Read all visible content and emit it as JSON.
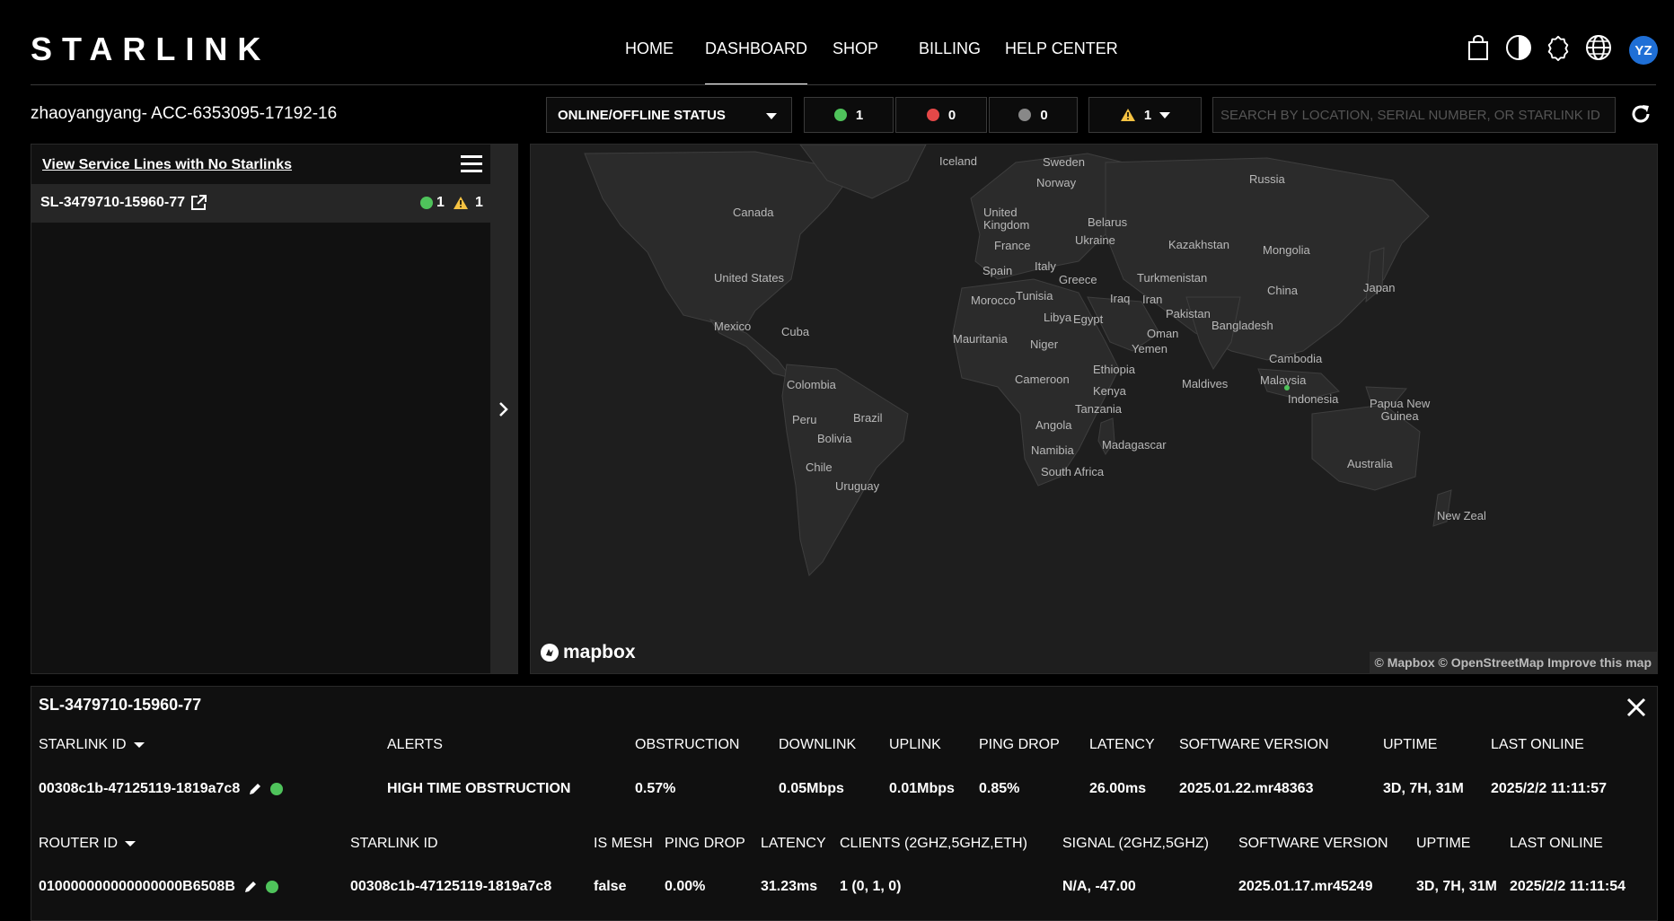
{
  "brand": {
    "logo": "STARLINK"
  },
  "nav": {
    "home": "HOME",
    "dashboard": "DASHBOARD",
    "shop": "SHOP",
    "billing": "BILLING",
    "help": "HELP CENTER"
  },
  "user": {
    "initials": "YZ"
  },
  "icons": [
    "cart-icon",
    "contrast-icon",
    "gear-icon",
    "globe-icon",
    "refresh-icon",
    "external-link-icon",
    "warning-icon",
    "edit-icon",
    "close-icon",
    "chevron-right-icon",
    "menu-icon",
    "mapbox-icon"
  ],
  "filters": {
    "account": "zhaoyangyang- ACC-6353095-17192-16",
    "status_dropdown": "ONLINE/OFFLINE STATUS",
    "online_count": "1",
    "offline_count": "0",
    "unknown_count": "0",
    "alert_count": "1",
    "search_placeholder": "SEARCH BY LOCATION, SERIAL NUMBER, OR STARLINK ID",
    "colors": {
      "online": "#4fc35b",
      "offline": "#e54848",
      "unknown": "#888888",
      "alert": "#f5c242"
    }
  },
  "left_panel": {
    "link": "View Service Lines with No Starlinks",
    "service_lines": [
      {
        "id": "SL-3479710-15960-77",
        "online": "1",
        "alerts": "1"
      }
    ]
  },
  "map": {
    "labels": {
      "iceland": "Iceland",
      "sweden": "Sweden",
      "norway": "Norway",
      "russia": "Russia",
      "canada": "Canada",
      "uk": "United\nKingdom",
      "belarus": "Belarus",
      "ukraine": "Ukraine",
      "france": "France",
      "kazakhstan": "Kazakhstan",
      "mongolia": "Mongolia",
      "spain": "Spain",
      "italy": "Italy",
      "greece": "Greece",
      "turkmenistan": "Turkmenistan",
      "us": "United States",
      "china": "China",
      "japan": "Japan",
      "morocco": "Morocco",
      "tunisia": "Tunisia",
      "iraq": "Iraq",
      "iran": "Iran",
      "pakistan": "Pakistan",
      "libya": "Libya",
      "egypt": "Egypt",
      "bangladesh": "Bangladesh",
      "mexico": "Mexico",
      "cuba": "Cuba",
      "oman": "Oman",
      "mauritania": "Mauritania",
      "niger": "Niger",
      "yemen": "Yemen",
      "cambodia": "Cambodia",
      "ethiopia": "Ethiopia",
      "cameroon": "Cameroon",
      "maldives": "Maldives",
      "malaysia": "Malaysia",
      "colombia": "Colombia",
      "kenya": "Kenya",
      "indonesia": "Indonesia",
      "png": "Papua New\nGuinea",
      "peru": "Peru",
      "brazil": "Brazil",
      "tanzania": "Tanzania",
      "bolivia": "Bolivia",
      "angola": "Angola",
      "madagascar": "Madagascar",
      "namibia": "Namibia",
      "australia": "Australia",
      "chile": "Chile",
      "south_africa": "South Africa",
      "uruguay": "Uruguay",
      "nz": "New Zeal"
    },
    "brand": "mapbox",
    "attribution": {
      "mapbox": "© Mapbox",
      "osm": "© OpenStreetMap",
      "improve": "Improve this map"
    }
  },
  "details": {
    "title": "SL-3479710-15960-77",
    "starlink_headers": {
      "starlink_id": "STARLINK ID",
      "alerts": "ALERTS",
      "obstruction": "OBSTRUCTION",
      "downlink": "DOWNLINK",
      "uplink": "UPLINK",
      "ping_drop": "PING DROP",
      "latency": "LATENCY",
      "software": "SOFTWARE VERSION",
      "uptime": "UPTIME",
      "last_online": "LAST ONLINE"
    },
    "starlink_row": {
      "starlink_id": "00308c1b-47125119-1819a7c8",
      "alerts": "HIGH TIME OBSTRUCTION",
      "obstruction": "0.57%",
      "downlink": "0.05Mbps",
      "uplink": "0.01Mbps",
      "ping_drop": "0.85%",
      "latency": "26.00ms",
      "software": "2025.01.22.mr48363",
      "uptime": "3D, 7H, 31M",
      "last_online": "2025/2/2 11:11:57"
    },
    "router_headers": {
      "router_id": "ROUTER ID",
      "starlink_id": "STARLINK ID",
      "is_mesh": "IS MESH",
      "ping_drop": "PING DROP",
      "latency": "LATENCY",
      "clients": "CLIENTS (2GHZ,5GHZ,ETH)",
      "signal": "SIGNAL (2GHZ,5GHZ)",
      "software": "SOFTWARE VERSION",
      "uptime": "UPTIME",
      "last_online": "LAST ONLINE"
    },
    "router_row": {
      "router_id": "010000000000000000B6508B",
      "starlink_id": "00308c1b-47125119-1819a7c8",
      "is_mesh": "false",
      "ping_drop": "0.00%",
      "latency": "31.23ms",
      "clients": "1 (0, 1, 0)",
      "signal": "N/A, -47.00",
      "software": "2025.01.17.mr45249",
      "uptime": "3D, 7H, 31M",
      "last_online": "2025/2/2 11:11:54"
    }
  }
}
